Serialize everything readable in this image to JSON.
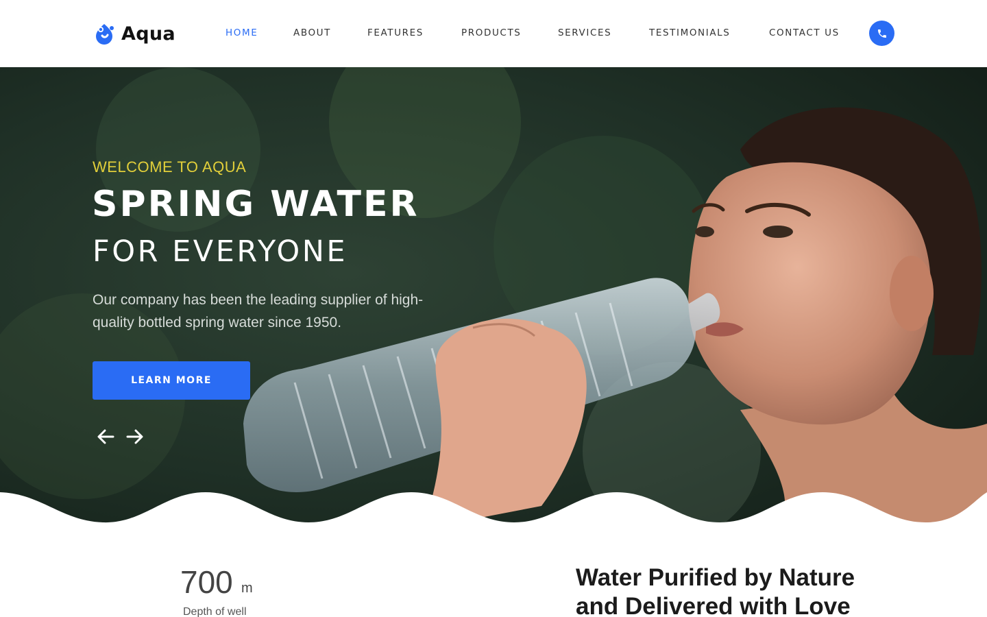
{
  "brand": {
    "name": "Aqua",
    "primary_color": "#2a6cf4",
    "accent_yellow": "#e2cf3a"
  },
  "nav": {
    "items": [
      {
        "label": "HOME",
        "active": true
      },
      {
        "label": "ABOUT",
        "active": false
      },
      {
        "label": "FEATURES",
        "active": false
      },
      {
        "label": "PRODUCTS",
        "active": false
      },
      {
        "label": "SERVICES",
        "active": false
      },
      {
        "label": "TESTIMONIALS",
        "active": false
      },
      {
        "label": "CONTACT US",
        "active": false
      }
    ],
    "phone_icon": "phone-icon"
  },
  "hero": {
    "welcome": "WELCOME TO AQUA",
    "title_line1": "SPRING WATER",
    "title_line2": "FOR EVERYONE",
    "description": "Our company has been the leading supplier of high-quality bottled spring water since 1950.",
    "cta_label": "LEARN MORE",
    "prev_icon": "arrow-left-icon",
    "next_icon": "arrow-right-icon",
    "image": "woman drinking from water bottle"
  },
  "stats": {
    "value": "700",
    "unit": "m",
    "label": "Depth of well"
  },
  "intro": {
    "title": "Water Purified by Nature and Delivered with Love"
  }
}
